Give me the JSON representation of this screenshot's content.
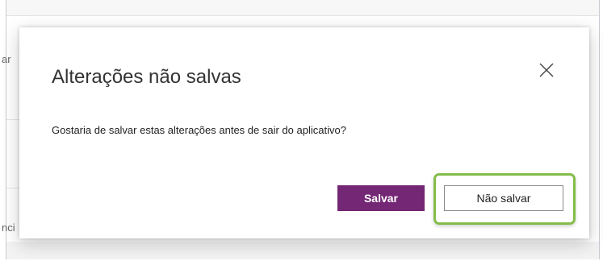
{
  "background": {
    "fragments": [
      "ar",
      "nci"
    ]
  },
  "dialog": {
    "title": "Alterações não salvas",
    "message": "Gostaria de salvar estas alterações antes de sair do aplicativo?",
    "close_icon": "close-icon",
    "buttons": {
      "save_label": "Salvar",
      "dont_save_label": "Não salvar"
    },
    "colors": {
      "primary_button": "#742774",
      "focus_ring": "#84bd4a"
    }
  }
}
